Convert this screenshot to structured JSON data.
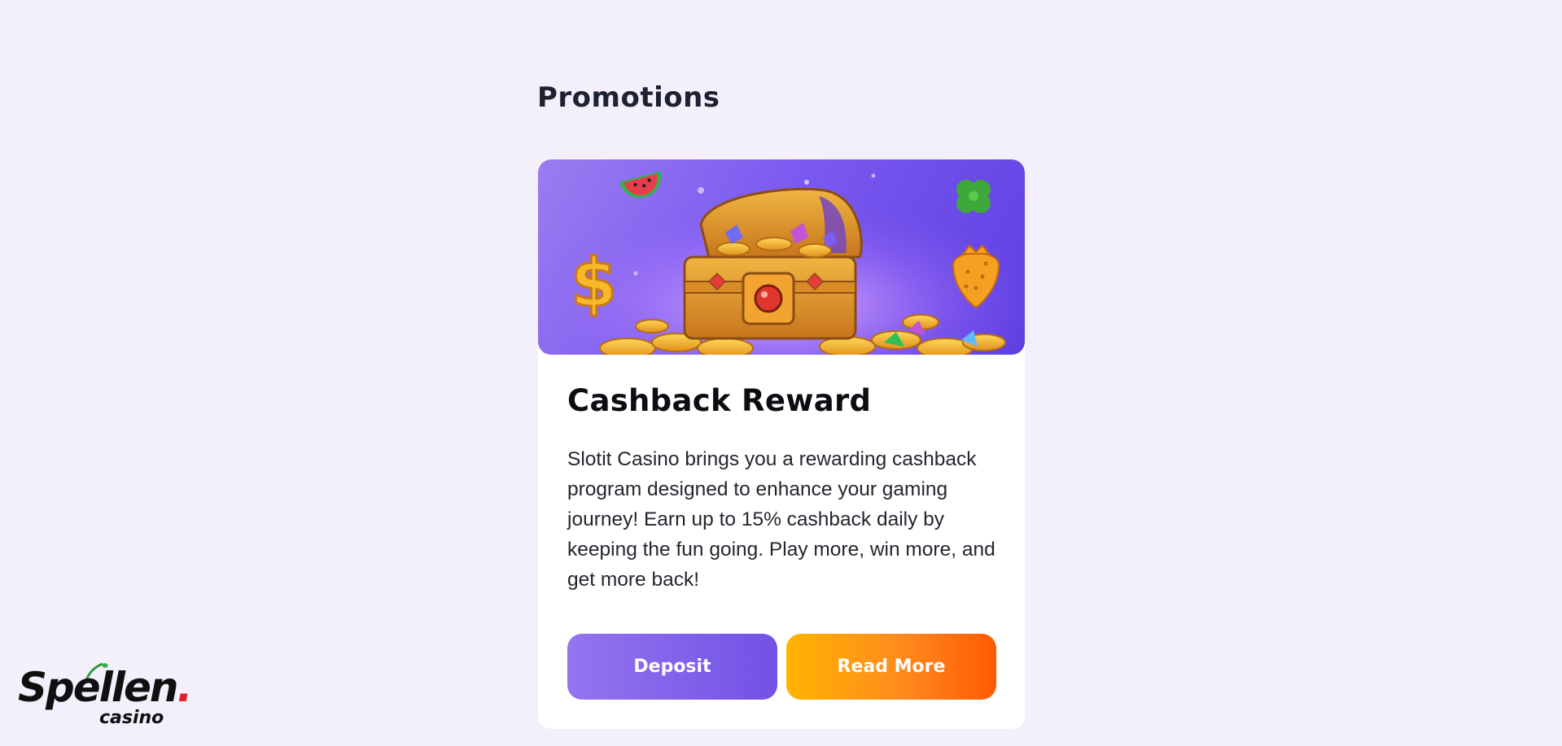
{
  "page": {
    "section_title": "Promotions"
  },
  "promo_card": {
    "banner_image": "treasure-chest-illustration",
    "title": "Cashback Reward",
    "description": "Slotit Casino brings you a rewarding cashback program designed to enhance your gaming journey! Earn up to 15% cashback daily by keeping the fun going. Play more, win more, and get more back!",
    "deposit_label": "Deposit",
    "read_more_label": "Read More"
  },
  "logo": {
    "main_text": "Spellen",
    "dot": ".",
    "sub_text": "casino"
  },
  "colors": {
    "background": "#f3f0fc",
    "deposit_button": "#7a5ae8",
    "read_more_button": "#ff8a1e",
    "banner": "#7a5af0",
    "logo_accent": "#e0202c"
  }
}
